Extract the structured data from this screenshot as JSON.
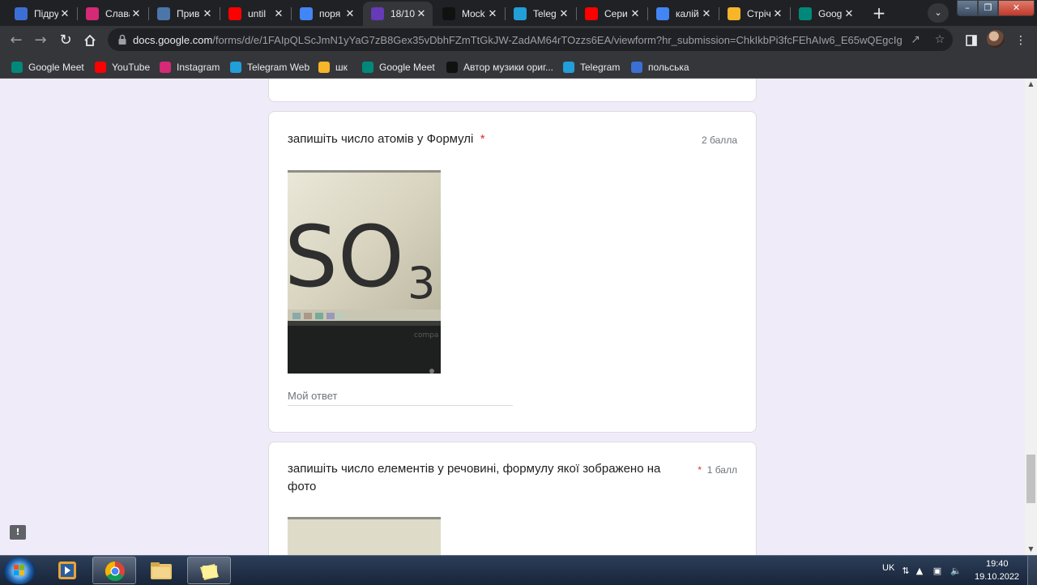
{
  "browser": {
    "tabs": [
      {
        "title": "Підру",
        "favicon": "ukraine-flag-icon",
        "color": "#3b6fd4"
      },
      {
        "title": "Слава",
        "favicon": "instagram-icon",
        "color": "#d62976"
      },
      {
        "title": "Прив",
        "favicon": "vkontakte-icon",
        "color": "#4a76a8"
      },
      {
        "title": "until",
        "favicon": "youtube-icon",
        "color": "#ff0000"
      },
      {
        "title": "поря",
        "favicon": "google-icon",
        "color": "#4285f4"
      },
      {
        "title": "18/10",
        "favicon": "google-forms-icon",
        "color": "#673ab7"
      },
      {
        "title": "Mock",
        "favicon": "tiktok-icon",
        "color": "#111111"
      },
      {
        "title": "Teleg",
        "favicon": "telegram-icon",
        "color": "#229ed9"
      },
      {
        "title": "Сери",
        "favicon": "youtube-icon",
        "color": "#ff0000"
      },
      {
        "title": "калій",
        "favicon": "google-icon",
        "color": "#4285f4"
      },
      {
        "title": "Стріч",
        "favicon": "google-classroom-icon",
        "color": "#f7b529"
      },
      {
        "title": "Goog",
        "favicon": "google-meet-icon",
        "color": "#00897b"
      }
    ],
    "active_tab": 5,
    "new_tab": "+",
    "url_host": "docs.google.com",
    "url_path": "/forms/d/e/1FAIpQLScJmN1yYaG7zB8Gex35vDbhFZmTtGkJW-ZadAM64rTOzzs6EA/viewform?hr_submission=ChkIkbPi3fcFEhAIw6_E65wQEgcIgJ..."
  },
  "bookmarks": [
    {
      "label": "Google Meet",
      "favicon": "google-meet-icon",
      "color": "#00897b"
    },
    {
      "label": "YouTube",
      "favicon": "youtube-icon",
      "color": "#ff0000"
    },
    {
      "label": "Instagram",
      "favicon": "instagram-icon",
      "color": "#d62976"
    },
    {
      "label": "Telegram Web",
      "favicon": "telegram-icon",
      "color": "#229ed9"
    },
    {
      "label": "шк",
      "favicon": "google-classroom-icon",
      "color": "#f7b529"
    },
    {
      "label": "Google Meet",
      "favicon": "google-meet-icon",
      "color": "#00897b"
    },
    {
      "label": "Автор музики ориг...",
      "favicon": "tiktok-icon",
      "color": "#111111"
    },
    {
      "label": "Telegram",
      "favicon": "telegram-icon",
      "color": "#229ed9"
    },
    {
      "label": "польська",
      "favicon": "ukraine-flag-icon",
      "color": "#3b6fd4"
    }
  ],
  "form": {
    "question1": {
      "title": "запишіть число атомів у Формулі",
      "required_mark": "*",
      "points": "2 балла",
      "image_formula": "SO",
      "image_subscript": "3",
      "image_bezel_text": "compa",
      "answer_placeholder": "Мой ответ"
    },
    "question2": {
      "title_line1": "запишіть число елементів у речовині, формулу якої зображено на",
      "title_line2": "фото",
      "required_mark": "*",
      "points": "1 балл"
    }
  },
  "taskbar": {
    "language": "UK",
    "time": "19:40",
    "date": "19.10.2022"
  }
}
